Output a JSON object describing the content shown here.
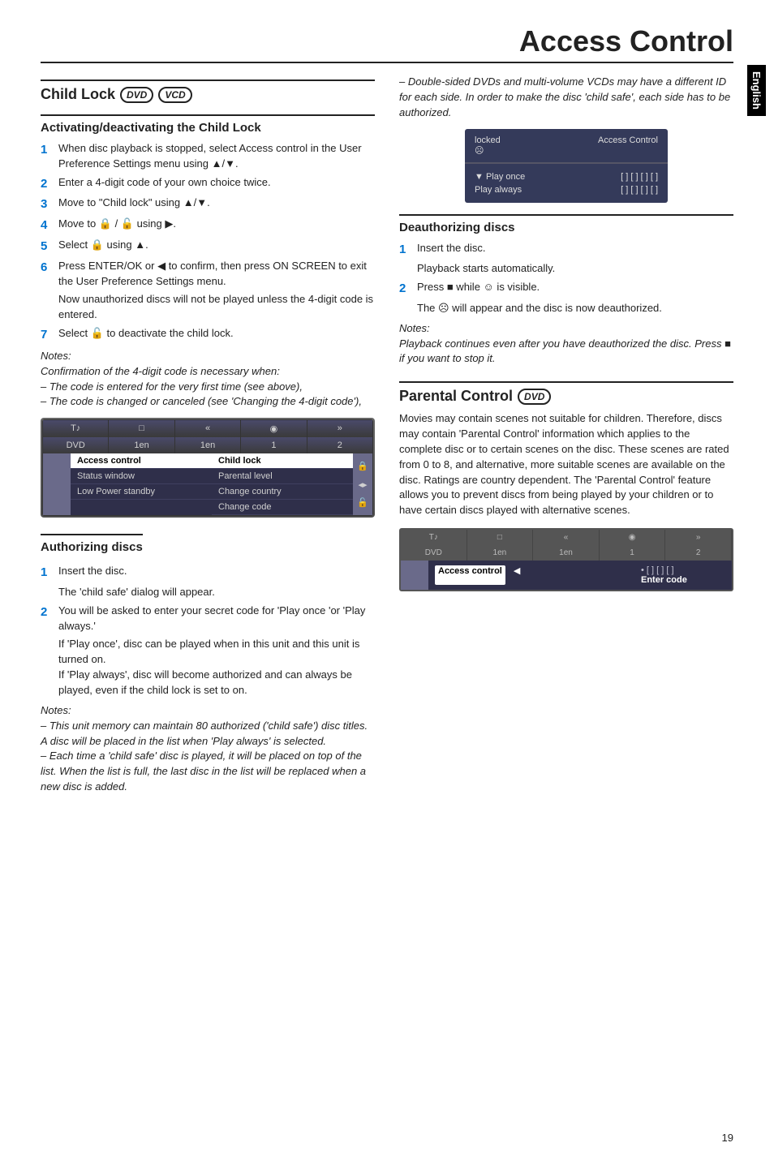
{
  "page": {
    "title": "Access Control",
    "side_tab": "English",
    "footer_page": "19"
  },
  "left": {
    "h2": "Child Lock",
    "badges": [
      "DVD",
      "VCD"
    ],
    "sub1": "Activating/deactivating the Child Lock",
    "steps1": [
      "When disc playback is stopped, select Access control in the User Preference Settings menu using ▲/▼.",
      "Enter a 4-digit code of your own choice twice.",
      "Move to \"Child lock\" using ▲/▼.",
      "Move to 🔒 / 🔓 using ▶.",
      "Select 🔒 using ▲.",
      "Press ENTER/OK or ◀ to confirm, then press ON SCREEN to exit the User Preference Settings menu."
    ],
    "indent1": "Now unauthorized discs will not be played unless the 4-digit code is entered.",
    "step7": "Select 🔓 to deactivate the child lock.",
    "notes1_h": "Notes:",
    "notes1": [
      "Confirmation of the 4-digit code is necessary when:",
      "– The code is entered for the very first time (see above),",
      "– The code is changed or canceled (see 'Changing the 4-digit code'),"
    ],
    "osd1": {
      "tabs_row1": [
        "",
        "",
        "",
        "",
        ""
      ],
      "tabs_row2": [
        "",
        "1en",
        "1en",
        "",
        ""
      ],
      "rows": [
        {
          "l": "Access control",
          "r": "Child lock",
          "hi": true
        },
        {
          "l": "Status window",
          "r": "Parental level"
        },
        {
          "l": "Low Power standby",
          "r": "Change country"
        },
        {
          "l": "",
          "r": "Change code"
        }
      ]
    },
    "sub2": "Authorizing discs",
    "steps2_1": "Insert the disc.",
    "indent2": "The 'child safe' dialog will appear.",
    "steps2_2": "You will be asked to enter your secret code for 'Play once 'or 'Play always.'",
    "para2a": "If 'Play once', disc can be played when in this unit and this unit is turned on.",
    "para2b": "If 'Play always', disc will become authorized and can always be played, even if the child lock is set to on.",
    "notes2_h": "Notes:",
    "notes2": [
      "– This unit memory can maintain 80 authorized ('child safe') disc titles. A disc will be placed in the list when 'Play always' is selected.",
      "– Each time a 'child safe' disc is played, it will be placed on top of the list. When the list is full, the last disc in the list will be replaced when a new disc is added."
    ]
  },
  "right": {
    "top_note": "– Double-sided DVDs and multi-volume VCDs may have a different ID for each side. In order to make the disc 'child safe', each side has to be authorized.",
    "osd_small": {
      "head_l": "locked",
      "head_r": "Access Control",
      "rows": [
        {
          "l": "▼  Play once",
          "r": "[ ]  [ ]  [ ]  [ ]"
        },
        {
          "l": "    Play always",
          "r": "[ ]  [ ]  [ ]  [ ]"
        }
      ]
    },
    "sub1": "Deauthorizing discs",
    "steps1_1": "Insert the disc.",
    "indent1": "Playback starts automatically.",
    "steps1_2": "Press ■ while ☺ is visible.",
    "indent2": "The ☹ will appear and the disc is now deauthorized.",
    "notes_h": "Notes:",
    "notes": "Playback continues even after you have deauthorized the disc. Press ■ if you want to stop it.",
    "h2": "Parental Control",
    "h2_badge": "DVD",
    "para": "Movies may contain scenes not suitable for children. Therefore, discs may contain 'Parental Control' information which applies to the complete disc or to certain scenes on the disc. These scenes are rated from 0 to 8, and alternative, more suitable scenes are available on the disc. Ratings are country dependent. The 'Parental Control' feature allows you to prevent discs from being played by your children or to have certain discs played with alternative scenes.",
    "osd2": {
      "tabs": [
        "",
        "",
        "1en",
        "1en",
        "",
        ""
      ],
      "left_label": "Access control",
      "right_top": "• [ ] [ ] [ ]",
      "right_bot": "Enter code"
    }
  }
}
